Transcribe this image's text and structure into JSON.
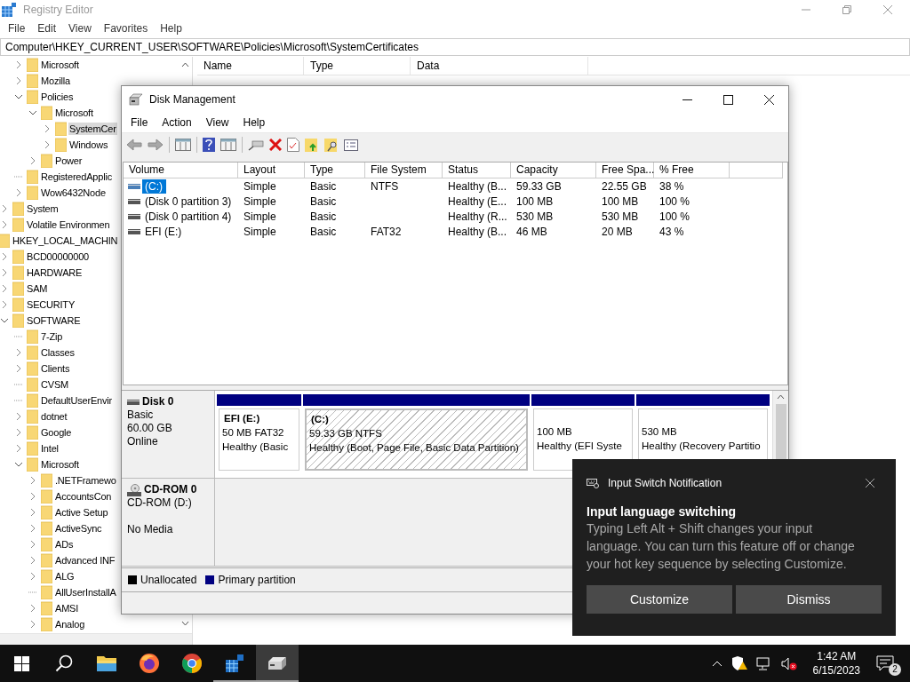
{
  "registry": {
    "title": "Registry Editor",
    "menu": [
      "File",
      "Edit",
      "View",
      "Favorites",
      "Help"
    ],
    "address": "Computer\\HKEY_CURRENT_USER\\SOFTWARE\\Policies\\Microsoft\\SystemCertificates",
    "tree": [
      {
        "children": [
          {
            "children": [
              {
                "label": "Microsoft",
                "kind": "branch",
                "expanded": false,
                "selected": false
              },
              {
                "label": "Mozilla",
                "kind": "branch",
                "expanded": false,
                "selected": false
              },
              {
                "label": "Policies",
                "kind": "branch",
                "expanded": true,
                "selected": false,
                "children": [
                  {
                    "label": "Microsoft",
                    "kind": "branch",
                    "expanded": true,
                    "selected": false,
                    "children": [
                      {
                        "label": "SystemCer",
                        "kind": "branch",
                        "expanded": false,
                        "selected": true
                      },
                      {
                        "label": "Windows",
                        "kind": "branch",
                        "expanded": false,
                        "selected": false
                      }
                    ]
                  },
                  {
                    "label": "Power",
                    "kind": "branch",
                    "expanded": false,
                    "selected": false
                  }
                ]
              },
              {
                "label": "RegisteredApplic",
                "kind": "leaf",
                "selected": false
              },
              {
                "label": "Wow6432Node",
                "kind": "branch",
                "expanded": false,
                "selected": false
              }
            ]
          },
          {
            "label": "System",
            "kind": "branch",
            "expanded": false,
            "selected": false
          },
          {
            "label": "Volatile Environmen",
            "kind": "branch",
            "expanded": false,
            "selected": false
          }
        ]
      },
      {
        "label": "HKEY_LOCAL_MACHIN",
        "kind": "root",
        "selected": false,
        "children": [
          {
            "label": "BCD00000000",
            "kind": "branch",
            "expanded": false,
            "selected": false
          },
          {
            "label": "HARDWARE",
            "kind": "branch",
            "expanded": false,
            "selected": false
          },
          {
            "label": "SAM",
            "kind": "branch",
            "expanded": false,
            "selected": false
          },
          {
            "label": "SECURITY",
            "kind": "branch",
            "expanded": false,
            "selected": false
          },
          {
            "label": "SOFTWARE",
            "kind": "branch",
            "expanded": true,
            "selected": false,
            "children": [
              {
                "label": "7-Zip",
                "kind": "leaf",
                "selected": false
              },
              {
                "label": "Classes",
                "kind": "branch",
                "expanded": false,
                "selected": false
              },
              {
                "label": "Clients",
                "kind": "branch",
                "expanded": false,
                "selected": false
              },
              {
                "label": "CVSM",
                "kind": "leaf",
                "selected": false
              },
              {
                "label": "DefaultUserEnvir",
                "kind": "leaf",
                "selected": false
              },
              {
                "label": "dotnet",
                "kind": "branch",
                "expanded": false,
                "selected": false
              },
              {
                "label": "Google",
                "kind": "branch",
                "expanded": false,
                "selected": false
              },
              {
                "label": "Intel",
                "kind": "branch",
                "expanded": false,
                "selected": false
              },
              {
                "label": "Microsoft",
                "kind": "branch",
                "expanded": true,
                "selected": false,
                "children": [
                  {
                    "label": ".NETFramewo",
                    "kind": "branch",
                    "expanded": false,
                    "selected": false
                  },
                  {
                    "label": "AccountsCon",
                    "kind": "branch",
                    "expanded": false,
                    "selected": false
                  },
                  {
                    "label": "Active Setup",
                    "kind": "branch",
                    "expanded": false,
                    "selected": false
                  },
                  {
                    "label": "ActiveSync",
                    "kind": "branch",
                    "expanded": false,
                    "selected": false
                  },
                  {
                    "label": "ADs",
                    "kind": "branch",
                    "expanded": false,
                    "selected": false
                  },
                  {
                    "label": "Advanced INF",
                    "kind": "branch",
                    "expanded": false,
                    "selected": false
                  },
                  {
                    "label": "ALG",
                    "kind": "branch",
                    "expanded": false,
                    "selected": false
                  },
                  {
                    "label": "AllUserInstallA",
                    "kind": "leaf",
                    "selected": false
                  },
                  {
                    "label": "AMSI",
                    "kind": "branch",
                    "expanded": false,
                    "selected": false
                  },
                  {
                    "label": "Analog",
                    "kind": "branch",
                    "expanded": false,
                    "selected": false
                  }
                ]
              }
            ]
          }
        ]
      }
    ],
    "columns": [
      "Name",
      "Type",
      "Data"
    ]
  },
  "disk_management": {
    "title": "Disk Management",
    "menu": [
      "File",
      "Action",
      "View",
      "Help"
    ],
    "table": {
      "columns": [
        "Volume",
        "Layout",
        "Type",
        "File System",
        "Status",
        "Capacity",
        "Free Spa...",
        "% Free"
      ],
      "rows": [
        {
          "selected": true,
          "cells": [
            "(C:)",
            "Simple",
            "Basic",
            "NTFS",
            "Healthy (B...",
            "59.33 GB",
            "22.55 GB",
            "38 %"
          ]
        },
        {
          "selected": false,
          "cells": [
            "(Disk 0 partition 3)",
            "Simple",
            "Basic",
            "",
            "Healthy (E...",
            "100 MB",
            "100 MB",
            "100 %"
          ]
        },
        {
          "selected": false,
          "cells": [
            "(Disk 0 partition 4)",
            "Simple",
            "Basic",
            "",
            "Healthy (R...",
            "530 MB",
            "530 MB",
            "100 %"
          ]
        },
        {
          "selected": false,
          "cells": [
            "EFI (E:)",
            "Simple",
            "Basic",
            "FAT32",
            "Healthy (B...",
            "46 MB",
            "20 MB",
            "43 %"
          ]
        }
      ]
    },
    "disks": [
      {
        "kind": "disk",
        "name": "Disk 0",
        "type_line": "Basic",
        "size_line": "60.00 GB",
        "status_line": "Online",
        "partitions": [
          {
            "name": "EFI  (E:)",
            "size": "50 MB FAT32",
            "status": "Healthy (Basic",
            "selected": false
          },
          {
            "name": "(C:)",
            "size": "59.33 GB NTFS",
            "status": "Healthy (Boot, Page File, Basic Data Partition)",
            "selected": true
          },
          {
            "size": "100 MB",
            "status": "Healthy (EFI Syste",
            "selected": false
          },
          {
            "size": "530 MB",
            "status": "Healthy (Recovery Partitio",
            "selected": false
          }
        ]
      },
      {
        "kind": "cdrom",
        "name": "CD-ROM 0",
        "type_line": "CD-ROM (D:)",
        "status_line": "No Media"
      }
    ],
    "legend": [
      {
        "label": "Unallocated",
        "color": "#000000"
      },
      {
        "label": "Primary partition",
        "color": "#000080"
      }
    ]
  },
  "notification": {
    "app": "Input Switch Notification",
    "title": "Input language switching",
    "body": "Typing Left Alt + Shift changes your input language. You can turn this feature off or change your hot key sequence by selecting Customize.",
    "buttons": [
      "Customize",
      "Dismiss"
    ]
  },
  "taskbar": {
    "apps": [
      {
        "kind": "explorer",
        "running": false,
        "selected": false
      },
      {
        "kind": "firefox",
        "running": false,
        "selected": false
      },
      {
        "kind": "chrome",
        "running": false,
        "selected": false
      },
      {
        "kind": "regedit",
        "running": true,
        "selected": false
      },
      {
        "kind": "diskmgmt",
        "running": true,
        "selected": true
      }
    ],
    "time": "1:42 AM",
    "date": "6/15/2023",
    "notification_count": "2"
  }
}
